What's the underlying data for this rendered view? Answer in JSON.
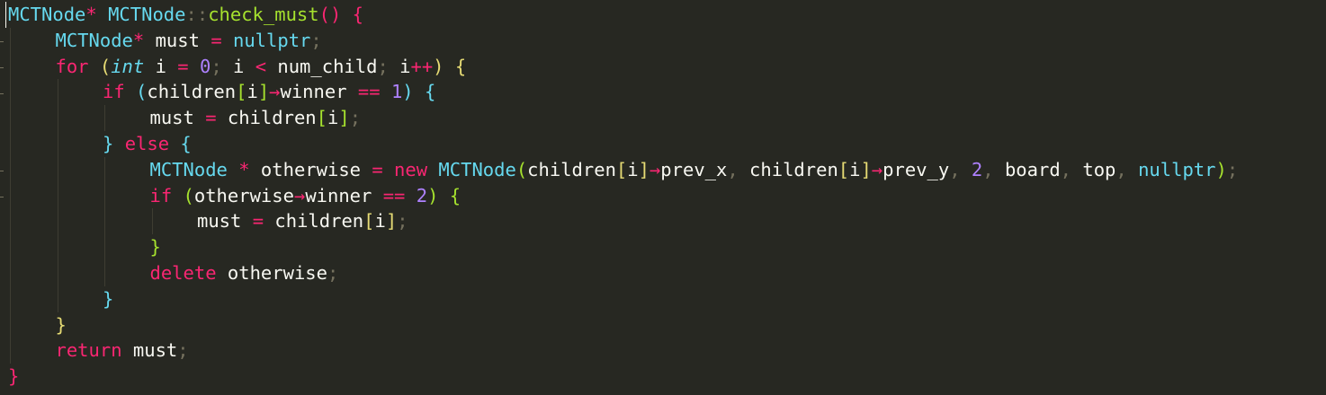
{
  "editor": {
    "language": "C++",
    "theme": "Monokai",
    "colors": {
      "background": "#272822",
      "keyword": "#f92672",
      "type": "#66d9ef",
      "function": "#a6e22e",
      "number": "#ae81ff",
      "operator": "#f92672",
      "text": "#f8f8f2",
      "indent_guide": "#3e3d32",
      "bracket_level_1": "#f92672",
      "bracket_level_2": "#e6db74",
      "bracket_level_3": "#66d9ef",
      "bracket_level_4": "#a6e22e"
    },
    "fold_marker_lines": [
      1,
      2,
      3,
      6,
      7
    ],
    "lines": [
      {
        "indent": 0,
        "tokens": [
          [
            "t",
            "MCTNode"
          ],
          [
            "o",
            "*"
          ],
          [
            "p",
            " "
          ],
          [
            "t",
            "MCTNode"
          ],
          [
            "c",
            "::"
          ],
          [
            "f",
            "check_must"
          ],
          [
            "b0",
            "()"
          ],
          [
            "p",
            " "
          ],
          [
            "b0",
            "{"
          ]
        ]
      },
      {
        "indent": 1,
        "tokens": [
          [
            "t",
            "MCTNode"
          ],
          [
            "o",
            "*"
          ],
          [
            "p",
            " must "
          ],
          [
            "o",
            "="
          ],
          [
            "p",
            " "
          ],
          [
            "t",
            "nullptr"
          ],
          [
            "c",
            ";"
          ]
        ]
      },
      {
        "indent": 1,
        "tokens": [
          [
            "k",
            "for"
          ],
          [
            "p",
            " "
          ],
          [
            "b1",
            "("
          ],
          [
            "ti",
            "int"
          ],
          [
            "p",
            " i "
          ],
          [
            "o",
            "="
          ],
          [
            "p",
            " "
          ],
          [
            "n",
            "0"
          ],
          [
            "c",
            ";"
          ],
          [
            "p",
            " i "
          ],
          [
            "o",
            "<"
          ],
          [
            "p",
            " num_child"
          ],
          [
            "c",
            ";"
          ],
          [
            "p",
            " i"
          ],
          [
            "o",
            "++"
          ],
          [
            "b1",
            ")"
          ],
          [
            "p",
            " "
          ],
          [
            "b1",
            "{"
          ]
        ]
      },
      {
        "indent": 2,
        "tokens": [
          [
            "k",
            "if"
          ],
          [
            "p",
            " "
          ],
          [
            "b2",
            "("
          ],
          [
            "p",
            "children"
          ],
          [
            "b3",
            "["
          ],
          [
            "p",
            "i"
          ],
          [
            "b3",
            "]"
          ],
          [
            "o",
            "→"
          ],
          [
            "p",
            "winner "
          ],
          [
            "o",
            "=="
          ],
          [
            "p",
            " "
          ],
          [
            "n",
            "1"
          ],
          [
            "b2",
            ")"
          ],
          [
            "p",
            " "
          ],
          [
            "b2",
            "{"
          ]
        ]
      },
      {
        "indent": 3,
        "tokens": [
          [
            "p",
            "must "
          ],
          [
            "o",
            "="
          ],
          [
            "p",
            " children"
          ],
          [
            "b3",
            "["
          ],
          [
            "p",
            "i"
          ],
          [
            "b3",
            "]"
          ],
          [
            "c",
            ";"
          ]
        ]
      },
      {
        "indent": 2,
        "tokens": [
          [
            "b2",
            "}"
          ],
          [
            "p",
            " "
          ],
          [
            "k",
            "else"
          ],
          [
            "p",
            " "
          ],
          [
            "b2",
            "{"
          ]
        ]
      },
      {
        "indent": 3,
        "tokens": [
          [
            "t",
            "MCTNode"
          ],
          [
            "p",
            " "
          ],
          [
            "o",
            "*"
          ],
          [
            "p",
            " otherwise "
          ],
          [
            "o",
            "="
          ],
          [
            "p",
            " "
          ],
          [
            "k",
            "new"
          ],
          [
            "p",
            " "
          ],
          [
            "t",
            "MCTNode"
          ],
          [
            "b3",
            "("
          ],
          [
            "p",
            "children"
          ],
          [
            "b1",
            "["
          ],
          [
            "p",
            "i"
          ],
          [
            "b1",
            "]"
          ],
          [
            "o",
            "→"
          ],
          [
            "p",
            "prev_x"
          ],
          [
            "c",
            ","
          ],
          [
            "p",
            " children"
          ],
          [
            "b1",
            "["
          ],
          [
            "p",
            "i"
          ],
          [
            "b1",
            "]"
          ],
          [
            "o",
            "→"
          ],
          [
            "p",
            "prev_y"
          ],
          [
            "c",
            ","
          ],
          [
            "p",
            " "
          ],
          [
            "n",
            "2"
          ],
          [
            "c",
            ","
          ],
          [
            "p",
            " board"
          ],
          [
            "c",
            ","
          ],
          [
            "p",
            " top"
          ],
          [
            "c",
            ","
          ],
          [
            "p",
            " "
          ],
          [
            "t",
            "nullptr"
          ],
          [
            "b3",
            ")"
          ],
          [
            "c",
            ";"
          ]
        ]
      },
      {
        "indent": 3,
        "tokens": [
          [
            "k",
            "if"
          ],
          [
            "p",
            " "
          ],
          [
            "b3",
            "("
          ],
          [
            "p",
            "otherwise"
          ],
          [
            "o",
            "→"
          ],
          [
            "p",
            "winner "
          ],
          [
            "o",
            "=="
          ],
          [
            "p",
            " "
          ],
          [
            "n",
            "2"
          ],
          [
            "b3",
            ")"
          ],
          [
            "p",
            " "
          ],
          [
            "b3",
            "{"
          ]
        ]
      },
      {
        "indent": 4,
        "tokens": [
          [
            "p",
            "must "
          ],
          [
            "o",
            "="
          ],
          [
            "p",
            " children"
          ],
          [
            "b1",
            "["
          ],
          [
            "p",
            "i"
          ],
          [
            "b1",
            "]"
          ],
          [
            "c",
            ";"
          ]
        ]
      },
      {
        "indent": 3,
        "tokens": [
          [
            "b3",
            "}"
          ]
        ]
      },
      {
        "indent": 3,
        "tokens": [
          [
            "k",
            "delete"
          ],
          [
            "p",
            " otherwise"
          ],
          [
            "c",
            ";"
          ]
        ]
      },
      {
        "indent": 2,
        "tokens": [
          [
            "b2",
            "}"
          ]
        ]
      },
      {
        "indent": 1,
        "tokens": [
          [
            "b1",
            "}"
          ]
        ]
      },
      {
        "indent": 1,
        "tokens": [
          [
            "k",
            "return"
          ],
          [
            "p",
            " must"
          ],
          [
            "c",
            ";"
          ]
        ]
      },
      {
        "indent": 0,
        "tokens": [
          [
            "b0",
            "}"
          ]
        ]
      }
    ]
  }
}
